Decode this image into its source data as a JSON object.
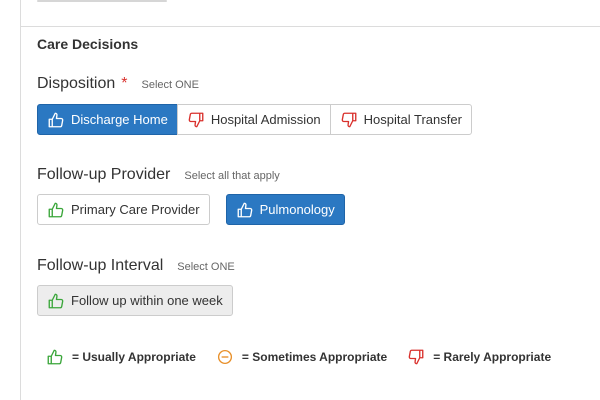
{
  "section": {
    "title": "Care Decisions"
  },
  "disposition": {
    "label": "Disposition",
    "required_mark": "*",
    "hint": "Select ONE",
    "options": [
      {
        "label": "Discharge Home",
        "rating": "usually",
        "selected": true
      },
      {
        "label": "Hospital Admission",
        "rating": "rarely",
        "selected": false
      },
      {
        "label": "Hospital Transfer",
        "rating": "rarely",
        "selected": false
      }
    ]
  },
  "followup_provider": {
    "label": "Follow-up Provider",
    "hint": "Select all that apply",
    "options": [
      {
        "label": "Primary Care Provider",
        "rating": "usually",
        "selected": false
      },
      {
        "label": "Pulmonology",
        "rating": "usually",
        "selected": true
      }
    ]
  },
  "followup_interval": {
    "label": "Follow-up Interval",
    "hint": "Select ONE",
    "options": [
      {
        "label": "Follow up within one week",
        "rating": "usually",
        "selected": false
      }
    ]
  },
  "legend": {
    "usually": "= Usually Appropriate",
    "sometimes": "= Sometimes Appropriate",
    "rarely": "= Rarely Appropriate"
  },
  "colors": {
    "selected_bg": "#2b78c2",
    "usually_icon": "#3aa63a",
    "sometimes_icon": "#e8902a",
    "rarely_icon": "#d9302c",
    "required": "#d9302c"
  },
  "icons": {
    "usually": "thumbs-up-icon",
    "sometimes": "minus-circle-icon",
    "rarely": "thumbs-down-icon"
  }
}
